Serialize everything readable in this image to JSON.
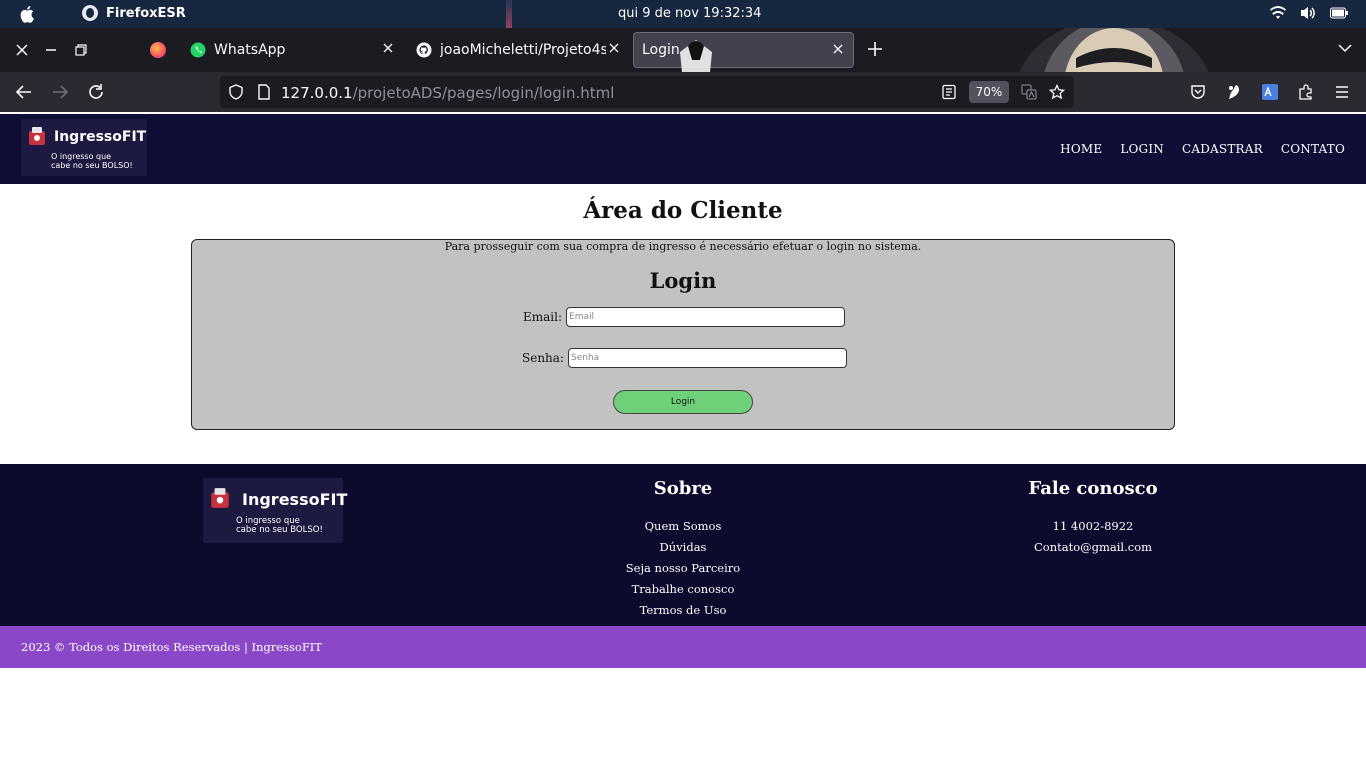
{
  "os": {
    "app_name": "FirefoxESR",
    "clock": "qui 9 de nov  19:32:34"
  },
  "browser": {
    "tabs": [
      {
        "label": "WhatsApp"
      },
      {
        "label": "joaoMicheletti/Projeto4s"
      },
      {
        "label": "Login"
      }
    ],
    "url_host": "127.0.0.1",
    "url_path": "/projetoADS/pages/login/login.html",
    "zoom": "70%"
  },
  "site": {
    "logo_title": "IngressoFIT",
    "logo_tagline_1": "O ingresso que",
    "logo_tagline_2": "cabe no seu BOLSO!",
    "nav": [
      "HOME",
      "LOGIN",
      "CADASTRAR",
      "CONTATO"
    ]
  },
  "main": {
    "title": "Área do Cliente",
    "notice": "Para prosseguir com sua compra de ingresso é necessário efetuar o login no sistema.",
    "form_title": "Login",
    "email_label": "Email:",
    "email_placeholder": "Email",
    "password_label": "Senha:",
    "password_placeholder": "Senha",
    "submit_label": "Login"
  },
  "footer": {
    "about_title": "Sobre",
    "about_links": [
      "Quem Somos",
      "Dúvidas",
      "Seja nosso Parceiro",
      "Trabalhe conosco",
      "Termos de Uso"
    ],
    "contact_title": "Fale conosco",
    "phone": "11 4002-8922",
    "email": "Contato@gmail.com",
    "copyright": "2023 © Todos os Direitos Reservados | IngressoFIT"
  },
  "colors": {
    "header_bg": "#0f0e36",
    "footer_bg": "#0c0b2d",
    "copyright_bg": "#8a47c8",
    "login_button": "#6fd07a",
    "card_bg": "#c2c2c2"
  }
}
